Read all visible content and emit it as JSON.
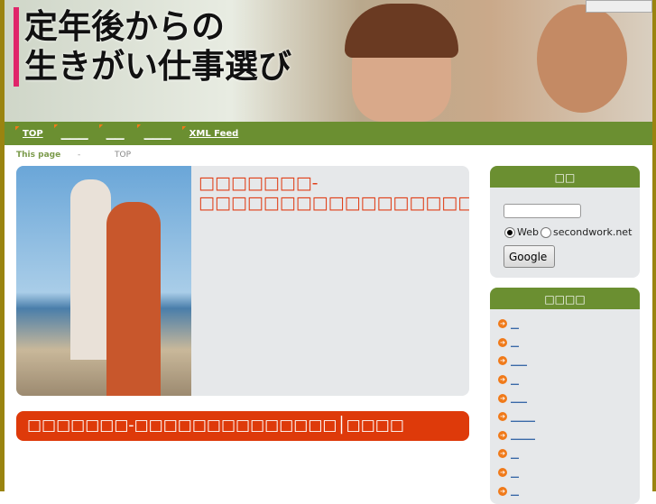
{
  "header": {
    "logo_text_line1": "定年後からの",
    "logo_text_line2": "生きがい仕事選び"
  },
  "nav": {
    "items": [
      {
        "label": "TOP"
      },
      {
        "label": "＿＿＿"
      },
      {
        "label": "＿＿"
      },
      {
        "label": "＿＿＿"
      },
      {
        "label": "XML Feed"
      }
    ]
  },
  "breadcrumb": {
    "label": "This page",
    "separator": "-",
    "current": "TOP"
  },
  "feature": {
    "title": "□□□□□□□-□□□□□□□□□□□□□□□□□□□□□"
  },
  "headline_bar": {
    "text": "□□□□□□□-□□□□□□□□□□□□□□│□□□□"
  },
  "search_box": {
    "title": "□□",
    "input_value": "",
    "radio_web": "Web",
    "radio_site": "secondwork.net",
    "button": "Google"
  },
  "links_box": {
    "title": "□□□□",
    "items": [
      "＿",
      "＿",
      "＿＿",
      "＿",
      "＿＿",
      "＿＿＿",
      "＿＿＿",
      "＿",
      "＿",
      "＿"
    ]
  }
}
